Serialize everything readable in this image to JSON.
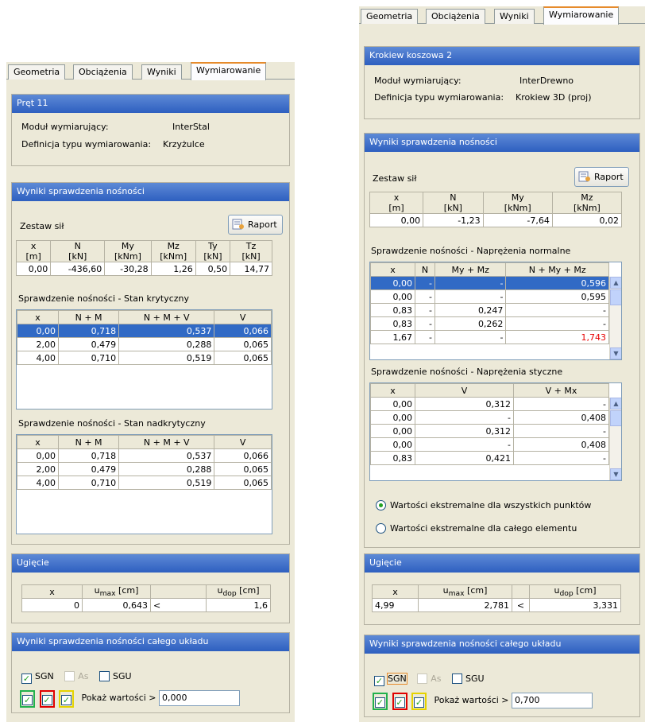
{
  "colors": {
    "header": "#3668c6",
    "selected_row": "#316ac5",
    "red_value": "#e80000",
    "active_tab_accent": "#e68b2c"
  },
  "tabs": [
    "Geometria",
    "Obciążenia",
    "Wyniki",
    "Wymiarowanie"
  ],
  "left": {
    "element_title": "Pręt 11",
    "module_label": "Moduł wymiarujący:",
    "module_value": "InterStal",
    "deftype_label": "Definicja typu wymiarowania:",
    "deftype_value": "Krzyżulce",
    "results_title": "Wyniki sprawdzenia nośności",
    "forces_label": "Zestaw sił",
    "raport_label": "Raport",
    "forces_headers": [
      [
        "x",
        "[m]"
      ],
      [
        "N",
        "[kN]"
      ],
      [
        "My",
        "[kNm]"
      ],
      [
        "Mz",
        "[kNm]"
      ],
      [
        "Ty",
        "[kN]"
      ],
      [
        "Tz",
        "[kN]"
      ]
    ],
    "forces_row": [
      "0,00",
      "-436,60",
      "-30,28",
      "1,26",
      "0,50",
      "14,77"
    ],
    "crit_title": "Sprawdzenie nośności - Stan krytyczny",
    "crit_headers": [
      "x",
      "N + M",
      "N + M + V",
      "V"
    ],
    "crit_rows": [
      [
        "0,00",
        "0,718",
        "0,537",
        "0,066"
      ],
      [
        "2,00",
        "0,479",
        "0,288",
        "0,065"
      ],
      [
        "4,00",
        "0,710",
        "0,519",
        "0,065"
      ]
    ],
    "supercrit_title": "Sprawdzenie nośności - Stan nadkrytyczny",
    "supercrit_headers": [
      "x",
      "N + M",
      "N + M + V",
      "V"
    ],
    "supercrit_rows": [
      [
        "0,00",
        "0,718",
        "0,537",
        "0,066"
      ],
      [
        "2,00",
        "0,479",
        "0,288",
        "0,065"
      ],
      [
        "4,00",
        "0,710",
        "0,519",
        "0,065"
      ]
    ],
    "deflection_title": "Ugięcie",
    "deflection_headers": {
      "x": "x",
      "umax": "u",
      "umax_sub": "max",
      "umax_unit": " [cm]",
      "udop": "u",
      "udop_sub": "dop",
      "udop_unit": " [cm]"
    },
    "deflection_row": {
      "x": "0",
      "umax": "0,643",
      "cmp": "<",
      "udop": "1,6"
    },
    "system_title": "Wyniki sprawdzenia nośności całego układu",
    "cb_sgn": "SGN",
    "cb_as": "As",
    "cb_sgu": "SGU",
    "show_values_label": "Pokaż wartości >",
    "show_values_value": "0,000"
  },
  "right": {
    "element_title": "Krokiew koszowa 2",
    "module_label": "Moduł wymiarujący:",
    "module_value": "InterDrewno",
    "deftype_label": "Definicja typu wymiarowania:",
    "deftype_value": "Krokiew 3D (proj)",
    "results_title": "Wyniki sprawdzenia nośności",
    "forces_label": "Zestaw sił",
    "raport_label": "Raport",
    "forces_headers": [
      [
        "x",
        "[m]"
      ],
      [
        "N",
        "[kN]"
      ],
      [
        "My",
        "[kNm]"
      ],
      [
        "Mz",
        "[kNm]"
      ]
    ],
    "forces_row": [
      "0,00",
      "-1,23",
      "-7,64",
      "0,02"
    ],
    "normal_title": "Sprawdzenie nośności - Naprężenia normalne",
    "normal_headers": [
      "x",
      "N",
      "My + Mz",
      "N + My + Mz"
    ],
    "normal_rows": [
      [
        "0,00",
        "-",
        "-",
        "0,596"
      ],
      [
        "0,00",
        "-",
        "-",
        "0,595"
      ],
      [
        "0,83",
        "-",
        "0,247",
        "-"
      ],
      [
        "0,83",
        "-",
        "0,262",
        "-"
      ],
      [
        "1,67",
        "-",
        "-",
        "1,743"
      ]
    ],
    "shear_title": "Sprawdzenie nośności - Naprężenia styczne",
    "shear_headers": [
      "x",
      "V",
      "V + Mx"
    ],
    "shear_rows": [
      [
        "0,00",
        "0,312",
        "-"
      ],
      [
        "0,00",
        "-",
        "0,408"
      ],
      [
        "0,00",
        "0,312",
        "-"
      ],
      [
        "0,00",
        "-",
        "0,408"
      ],
      [
        "0,83",
        "0,421",
        "-"
      ]
    ],
    "radio_all_points": "Wartości ekstremalne dla wszystkich punktów",
    "radio_whole_element": "Wartości ekstremalne dla całego elementu",
    "deflection_title": "Ugięcie",
    "deflection_headers": {
      "x": "x",
      "umax": "u",
      "umax_sub": "max",
      "umax_unit": " [cm]",
      "udop": "u",
      "udop_sub": "dop",
      "udop_unit": " [cm]"
    },
    "deflection_row": {
      "x": "4,99",
      "umax": "2,781",
      "cmp": "<",
      "udop": "3,331"
    },
    "system_title": "Wyniki sprawdzenia nośności całego układu",
    "cb_sgn": "SGN",
    "cb_as": "As",
    "cb_sgu": "SGU",
    "show_values_label": "Pokaż wartości >",
    "show_values_value": "0,700"
  }
}
